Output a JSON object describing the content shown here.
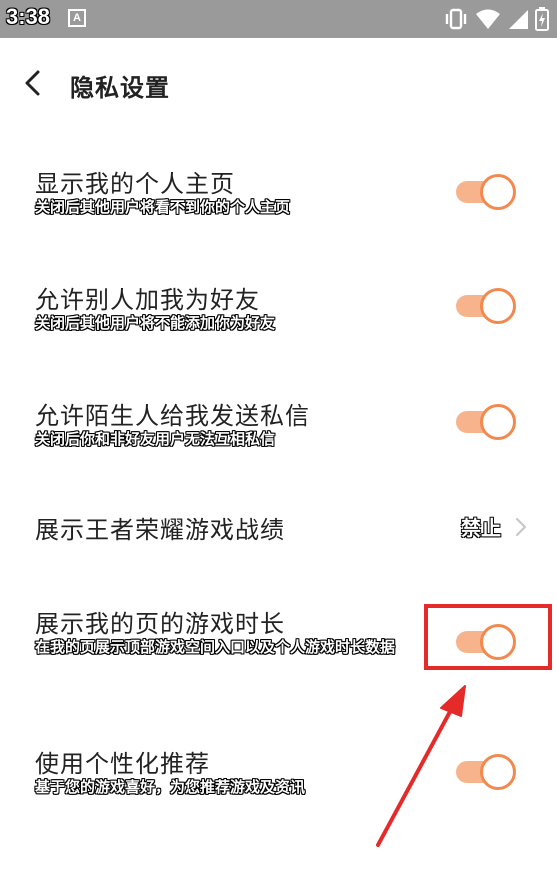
{
  "status_bar": {
    "time": "3:38",
    "notification_icon": "A",
    "icons": [
      "vibrate-icon",
      "wifi-icon",
      "signal-icon",
      "battery-icon"
    ]
  },
  "header": {
    "back_icon": "chevron-left-icon",
    "title": "隐私设置"
  },
  "settings": [
    {
      "title": "显示我的个人主页",
      "desc": "关闭后其他用户将看不到你的个人主页",
      "type": "toggle",
      "on": true
    },
    {
      "title": "允许别人加我为好友",
      "desc": "关闭后其他用户将不能添加你为好友",
      "type": "toggle",
      "on": true
    },
    {
      "title": "允许陌生人给我发送私信",
      "desc": "关闭后你和非好友用户无法互相私信",
      "type": "toggle",
      "on": true
    },
    {
      "title": "展示王者荣耀游戏战绩",
      "type": "link",
      "value": "禁止"
    },
    {
      "title": "展示我的页的游戏时长",
      "desc": "在我的页展示顶部游戏空间入口以及个人游戏时长数据",
      "type": "toggle",
      "on": true
    },
    {
      "title": "使用个性化推荐",
      "desc": "基于您的游戏喜好，为您推荐游戏及资讯",
      "type": "toggle",
      "on": true
    }
  ],
  "colors": {
    "accent": "#f2894f",
    "track": "#f7b48c",
    "annotation": "#e52a2a",
    "status_bar": "#9a9a9a"
  }
}
